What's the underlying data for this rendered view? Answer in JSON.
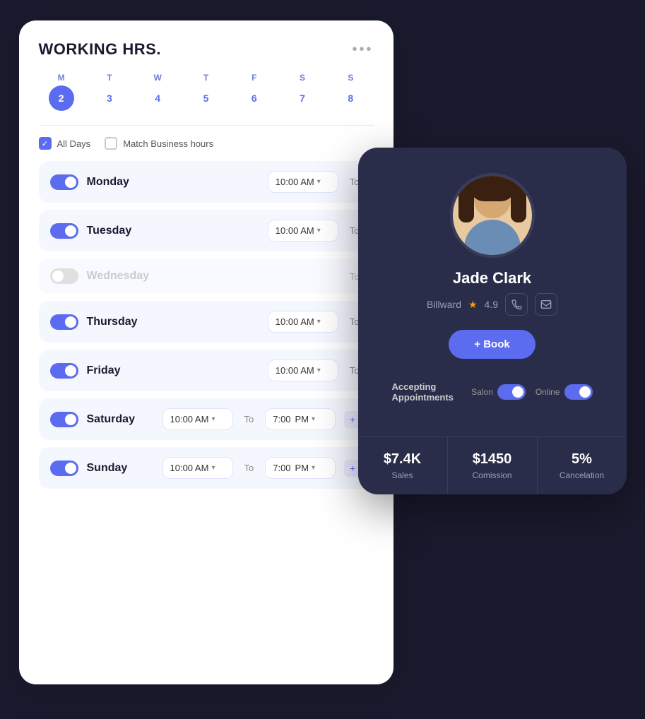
{
  "workingCard": {
    "title": "WORKING HRS.",
    "moreDots": "•••",
    "weekDays": [
      {
        "label": "M",
        "num": "2",
        "active": true
      },
      {
        "label": "T",
        "num": "3",
        "active": false
      },
      {
        "label": "W",
        "num": "4",
        "active": false
      },
      {
        "label": "T",
        "num": "5",
        "active": false
      },
      {
        "label": "F",
        "num": "6",
        "active": false
      },
      {
        "label": "S",
        "num": "7",
        "active": false
      },
      {
        "label": "S",
        "num": "8",
        "active": false
      }
    ],
    "allDaysLabel": "All Days",
    "matchLabel": "Match Business hours",
    "days": [
      {
        "name": "Monday",
        "enabled": true,
        "startTime": "10:00 AM",
        "hasEnd": false
      },
      {
        "name": "Tuesday",
        "enabled": true,
        "startTime": "10:00 AM",
        "hasEnd": false
      },
      {
        "name": "Wednesday",
        "enabled": false,
        "startTime": "",
        "hasEnd": false
      },
      {
        "name": "Thursday",
        "enabled": true,
        "startTime": "10:00 AM",
        "hasEnd": false
      },
      {
        "name": "Friday",
        "enabled": true,
        "startTime": "10:00 AM",
        "hasEnd": false
      },
      {
        "name": "Saturday",
        "enabled": true,
        "startTime": "10:00 AM",
        "endTime": "7:00 PM",
        "hasEnd": true
      },
      {
        "name": "Sunday",
        "enabled": true,
        "startTime": "10:00 AM",
        "endTime": "7:00 PM",
        "hasEnd": true
      }
    ]
  },
  "profileCard": {
    "name": "Jade Clark",
    "company": "Billward",
    "rating": "4.9",
    "bookLabel": "+ Book",
    "acceptingLabel": "Accepting Appointments",
    "salonLabel": "Salon",
    "onlineLabel": "Online",
    "stats": [
      {
        "value": "$7.4K",
        "label": "Sales"
      },
      {
        "value": "$1450",
        "label": "Comission"
      },
      {
        "value": "5%",
        "label": "Cancelation"
      }
    ]
  }
}
